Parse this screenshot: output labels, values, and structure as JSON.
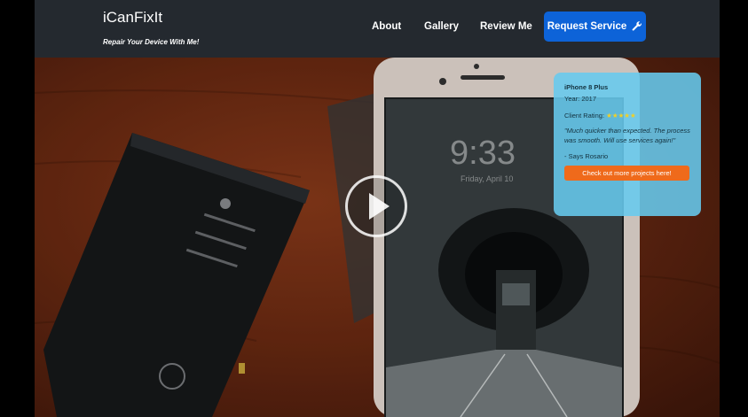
{
  "brand": {
    "name": "iCanFixIt",
    "tagline": "Repair Your Device With Me!"
  },
  "nav": {
    "links": [
      {
        "label": "About"
      },
      {
        "label": "Gallery"
      },
      {
        "label": "Review Me"
      }
    ],
    "request_button": {
      "label": "Request Service",
      "icon": "wrench-icon"
    }
  },
  "hero": {
    "play_icon": "play-icon",
    "photo_text": {
      "time": "9:33",
      "date": "Friday, April 10"
    }
  },
  "review_card": {
    "device": "iPhone 8 Plus",
    "year": "Year: 2017",
    "rating_label": "Client Rating:",
    "rating_stars": 5,
    "rating_text": "★★★★★",
    "quote": "\"Much quicker than expected. The process was smooth. Will use services again!\"",
    "author": "- Says Rosario",
    "cta_label": "Check out more projects here!"
  },
  "colors": {
    "navbar": "#24292f",
    "primary": "#0d63d8",
    "card": "#66caee",
    "cta": "#ef6a1b",
    "stars": "#f2d024"
  }
}
